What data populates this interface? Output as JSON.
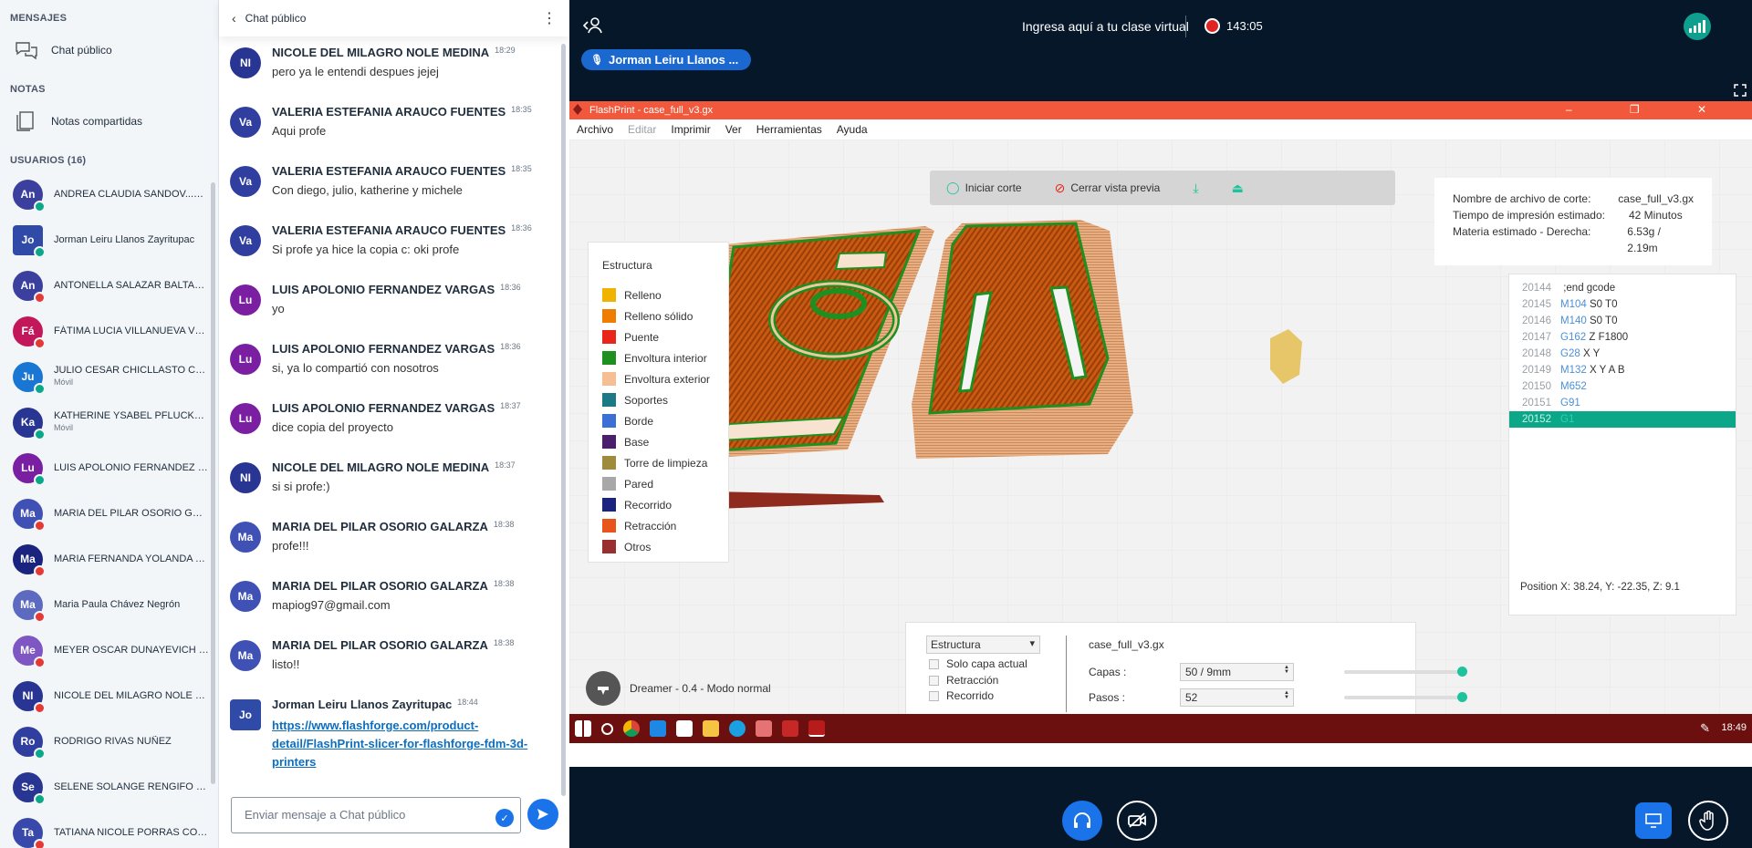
{
  "sidebar": {
    "messages_section": "MENSAJES",
    "public_chat": "Chat público",
    "notes_section": "NOTAS",
    "shared_notes": "Notas compartidas",
    "users_section": "USUARIOS (16)",
    "users": [
      {
        "initials": "An",
        "name": "ANDREA CLAUDIA SANDOV...",
        "you": "(Usted)",
        "color": "#3b3f9e",
        "status": "green"
      },
      {
        "initials": "Jo",
        "name": "Jorman Leiru Llanos Zayritupac",
        "color": "#2f4aa7",
        "status": "green",
        "presenter": true
      },
      {
        "initials": "An",
        "name": "ANTONELLA SALAZAR BALTAZAR",
        "color": "#3b3f9e",
        "status": "red"
      },
      {
        "initials": "Fá",
        "name": "FÁTIMA LUCIA VILLANUEVA VENEG...",
        "color": "#c2185b",
        "status": "red"
      },
      {
        "initials": "Ju",
        "name": "JULIO CESAR CHICLLASTO CHIPANA",
        "sub": "Móvil",
        "color": "#1976d2",
        "status": "green"
      },
      {
        "initials": "Ka",
        "name": "KATHERINE YSABEL PFLUCKER GU...",
        "sub": "Móvil",
        "color": "#283593",
        "status": "green"
      },
      {
        "initials": "Lu",
        "name": "LUIS APOLONIO FERNANDEZ VARG...",
        "color": "#7b1fa2",
        "status": "green"
      },
      {
        "initials": "Ma",
        "name": "MARIA DEL PILAR OSORIO GALARZA",
        "color": "#3f51b5",
        "status": "red"
      },
      {
        "initials": "Ma",
        "name": "MARIA FERNANDA YOLANDA TOVA...",
        "color": "#1a237e",
        "status": "red"
      },
      {
        "initials": "Ma",
        "name": "Maria Paula Chávez Negrón",
        "color": "#5c6bc0",
        "status": "red"
      },
      {
        "initials": "Me",
        "name": "MEYER OSCAR DUNAYEVICH VARGAS",
        "color": "#7e57c2",
        "status": "red"
      },
      {
        "initials": "NI",
        "name": "NICOLE DEL MILAGRO NOLE MEDINA",
        "color": "#283593",
        "status": "red"
      },
      {
        "initials": "Ro",
        "name": "RODRIGO RIVAS NUÑEZ",
        "color": "#303f9f",
        "status": "green"
      },
      {
        "initials": "Se",
        "name": "SELENE SOLANGE RENGIFO RAMIR...",
        "color": "#283593",
        "status": "green"
      },
      {
        "initials": "Ta",
        "name": "TATIANA NICOLE PORRAS CONTRE...",
        "color": "#3949ab",
        "status": "red"
      }
    ]
  },
  "chat": {
    "header": "Chat público",
    "messages": [
      {
        "initials": "NI",
        "color": "#283593",
        "name": "NICOLE DEL MILAGRO NOLE MEDINA",
        "time": "18:29",
        "text": "pero ya le entendi despues jejej"
      },
      {
        "initials": "Va",
        "color": "#303f9f",
        "name": "VALERIA ESTEFANIA ARAUCO FUENTES",
        "time": "18:35",
        "text": "Aqui profe"
      },
      {
        "initials": "Va",
        "color": "#303f9f",
        "name": "VALERIA ESTEFANIA ARAUCO FUENTES",
        "time": "18:35",
        "text": "Con diego, julio, katherine y michele"
      },
      {
        "initials": "Va",
        "color": "#303f9f",
        "name": "VALERIA ESTEFANIA ARAUCO FUENTES",
        "time": "18:36",
        "text": "Si profe ya hice la copia c: oki profe"
      },
      {
        "initials": "Lu",
        "color": "#7b1fa2",
        "name": "LUIS APOLONIO FERNANDEZ VARGAS",
        "time": "18:36",
        "text": "yo"
      },
      {
        "initials": "Lu",
        "color": "#7b1fa2",
        "name": "LUIS APOLONIO FERNANDEZ VARGAS",
        "time": "18:36",
        "text": "si, ya lo compartió con nosotros"
      },
      {
        "initials": "Lu",
        "color": "#7b1fa2",
        "name": "LUIS APOLONIO FERNANDEZ VARGAS",
        "time": "18:37",
        "text": "dice copia del proyecto"
      },
      {
        "initials": "NI",
        "color": "#283593",
        "name": "NICOLE DEL MILAGRO NOLE MEDINA",
        "time": "18:37",
        "text": "si si profe:)"
      },
      {
        "initials": "Ma",
        "color": "#3f51b5",
        "name": "MARIA DEL PILAR OSORIO GALARZA",
        "time": "18:38",
        "text": "profe!!!"
      },
      {
        "initials": "Ma",
        "color": "#3f51b5",
        "name": "MARIA DEL PILAR OSORIO GALARZA",
        "time": "18:38",
        "text": "mapiog97@gmail.com"
      },
      {
        "initials": "Ma",
        "color": "#3f51b5",
        "name": "MARIA DEL PILAR OSORIO GALARZA",
        "time": "18:38",
        "text": "listo!!"
      }
    ],
    "last": {
      "initials": "Jo",
      "color": "#2f4aa7",
      "name": "Jorman Leiru Llanos Zayritupac",
      "time": "18:44",
      "link": "https://www.flashforge.com/product-detail/FlashPrint-slicer-for-flashforge-fdm-3d-printers"
    },
    "input_placeholder": "Enviar mensaje a Chat público"
  },
  "topbar": {
    "title": "Ingresa aquí a tu clase virtual",
    "timer": "143:05",
    "presenter": "Jorman Leiru Llanos ..."
  },
  "flashprint": {
    "window_title": "FlashPrint - case_full_v3.gx",
    "menu": [
      "Archivo",
      "Editar",
      "Imprimir",
      "Ver",
      "Herramientas",
      "Ayuda"
    ],
    "disabled_menu": "Editar",
    "start_slice": "Iniciar corte",
    "close_preview": "Cerrar vista previa",
    "legend_title": "Estructura",
    "legend": [
      {
        "label": "Relleno",
        "color": "#f0b400"
      },
      {
        "label": "Relleno sólido",
        "color": "#ef7d00"
      },
      {
        "label": "Puente",
        "color": "#e8261a"
      },
      {
        "label": "Envoltura interior",
        "color": "#1f8f1f"
      },
      {
        "label": "Envoltura exterior",
        "color": "#f5bf93"
      },
      {
        "label": "Soportes",
        "color": "#1b7a86"
      },
      {
        "label": "Borde",
        "color": "#3b6fd6"
      },
      {
        "label": "Base",
        "color": "#4b1f6b"
      },
      {
        "label": "Torre de limpieza",
        "color": "#a08a3c"
      },
      {
        "label": "Pared",
        "color": "#a8a8a8"
      },
      {
        "label": "Recorrido",
        "color": "#1a237e"
      },
      {
        "label": "Retracción",
        "color": "#e8551a"
      },
      {
        "label": "Otros",
        "color": "#9a2f2f"
      }
    ],
    "info": [
      {
        "k": "Nombre de archivo de corte:",
        "v": "case_full_v3.gx"
      },
      {
        "k": "Tiempo de impresión estimado:",
        "v": "42 Minutos"
      },
      {
        "k": "Materia estimado - Derecha:",
        "v": "6.53g / 2.19m"
      }
    ],
    "gcode": [
      {
        "n": "20144",
        "c": "",
        "t": ";end gcode"
      },
      {
        "n": "20145",
        "c": "M104",
        "t": "S0 T0"
      },
      {
        "n": "20146",
        "c": "M140",
        "t": "S0 T0"
      },
      {
        "n": "20147",
        "c": "G162",
        "t": "Z F1800"
      },
      {
        "n": "20148",
        "c": "G28",
        "t": "X Y"
      },
      {
        "n": "20149",
        "c": "M132",
        "t": "X Y A B"
      },
      {
        "n": "20150",
        "c": "M652",
        "t": ""
      },
      {
        "n": "20151",
        "c": "G91",
        "t": ""
      },
      {
        "n": "20152",
        "c": "G1",
        "t": "",
        "selected": true
      }
    ],
    "position": "Position   X: 38.24, Y: -22.35, Z: 9.1",
    "structure_select": "Estructura",
    "checkboxes": [
      "Solo capa actual",
      "Retracción",
      "Recorrido"
    ],
    "file": "case_full_v3.gx",
    "layers_label": "Capas :",
    "layers_value": "50 / 9mm",
    "steps_label": "Pasos :",
    "steps_value": "52",
    "printer": "Dreamer - 0.4 - Modo normal",
    "clock": "18:49"
  },
  "colors": {
    "accent": "#1a73e8",
    "flashprint": "#f1583c",
    "background": "#06172a",
    "green": "#0aa889"
  }
}
